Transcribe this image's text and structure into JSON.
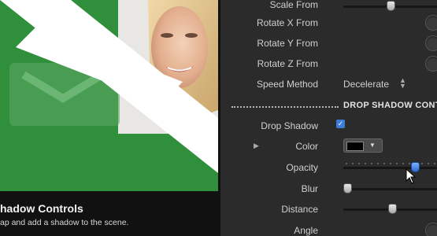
{
  "preview": {
    "caption_title": "hadow Controls",
    "caption_desc": "ap and add a shadow to the scene."
  },
  "inspector": {
    "rows": {
      "scale_from": "Scale From",
      "rotate_x": "Rotate X From",
      "rotate_y": "Rotate Y From",
      "rotate_z": "Rotate Z From",
      "speed_method": "Speed Method",
      "speed_method_value": "Decelerate"
    },
    "section_title": "DROP SHADOW CONTROLS",
    "drop_shadow": {
      "label": "Drop Shadow",
      "checked": true,
      "check_glyph": "✓"
    },
    "color": {
      "label": "Color",
      "value": "#000000"
    },
    "opacity": {
      "label": "Opacity",
      "value": 0.75
    },
    "blur": {
      "label": "Blur",
      "value": 0.0
    },
    "distance": {
      "label": "Distance",
      "value": 0.5
    },
    "angle": {
      "label": "Angle"
    }
  },
  "colors": {
    "preview_green": "#2f8f3a",
    "accent_blue": "#3b7dd8"
  }
}
